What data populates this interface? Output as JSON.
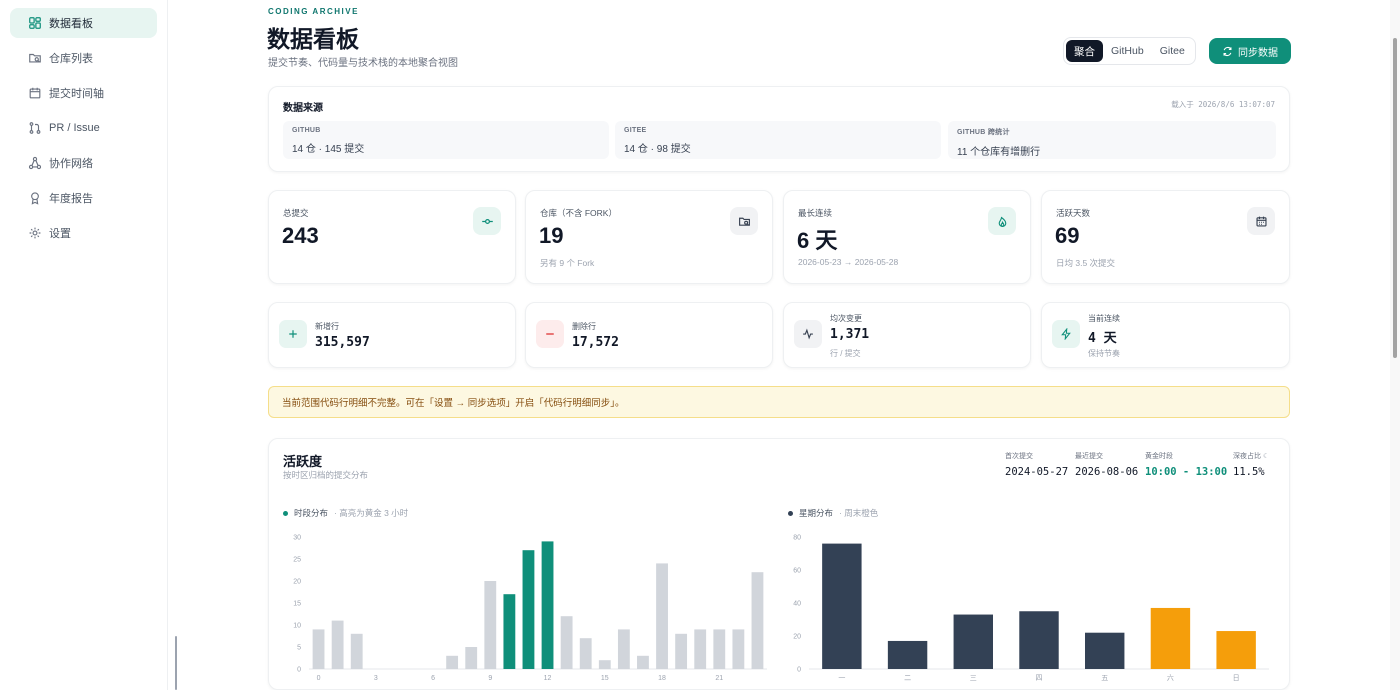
{
  "sidebar": {
    "items": [
      {
        "label": "数据看板",
        "icon": "dashboard-icon",
        "active": true
      },
      {
        "label": "仓库列表",
        "icon": "folder-search-icon"
      },
      {
        "label": "提交时间轴",
        "icon": "calendar-icon"
      },
      {
        "label": "PR / Issue",
        "icon": "git-pull-request-icon"
      },
      {
        "label": "协作网络",
        "icon": "network-icon"
      },
      {
        "label": "年度报告",
        "icon": "award-icon"
      },
      {
        "label": "设置",
        "icon": "gear-icon"
      }
    ]
  },
  "header": {
    "eyebrow": "CODING ARCHIVE",
    "title": "数据看板",
    "subtitle": "提交节奏、代码量与技术栈的本地聚合视图",
    "sources": [
      "聚合",
      "GitHub",
      "Gitee"
    ],
    "active_source": "聚合",
    "sync_label": "同步数据",
    "sync_icon": "refresh-icon"
  },
  "data_source": {
    "title": "数据来源",
    "loaded_at": "载入于 2026/8/6 13:07:07",
    "cells": [
      {
        "label": "GITHUB",
        "value": "14 仓 · 145 提交"
      },
      {
        "label": "GITEE",
        "value": "14 仓 · 98 提交"
      },
      {
        "label": "GITHUB 跨统计",
        "value": "11 个仓库有增删行"
      }
    ]
  },
  "stats": [
    {
      "label": "总提交",
      "value": "243",
      "sub": "",
      "icon": "commit-icon"
    },
    {
      "label": "仓库（不含 FORK）",
      "value": "19",
      "sub": "另有 9 个 Fork",
      "icon": "folder-search-icon"
    },
    {
      "label": "最长连续",
      "value": "6 天",
      "sub": "2026-05-23 → 2026-05-28",
      "icon": "flame-icon"
    },
    {
      "label": "活跃天数",
      "value": "69",
      "sub": "日均 3.5 次提交",
      "icon": "calendar-icon"
    }
  ],
  "metrics": [
    {
      "label": "新增行",
      "value": "315,597",
      "sub": "",
      "icon": "plus-icon"
    },
    {
      "label": "删除行",
      "value": "17,572",
      "sub": "",
      "icon": "minus-icon"
    },
    {
      "label": "均次变更",
      "value": "1,371",
      "sub": "行 / 提交",
      "icon": "activity-icon"
    },
    {
      "label": "当前连续",
      "value": "4 天",
      "sub": "保持节奏",
      "icon": "zap-icon"
    }
  ],
  "warning": "当前范围代码行明细不完整。可在「设置 → 同步选项」开启「代码行明细同步」。",
  "activity": {
    "title": "活跃度",
    "subtitle": "按时区归档的提交分布",
    "kpis": [
      {
        "label": "首次提交",
        "value": "2024-05-27"
      },
      {
        "label": "最近提交",
        "value": "2026-08-06"
      },
      {
        "label": "黄金时段",
        "value": "10:00 - 13:00"
      },
      {
        "label": "深夜占比",
        "value": "11.5%"
      }
    ],
    "hour_chart_title": "时段分布",
    "hour_chart_note": "· 高亮为黄金 3 小时",
    "week_chart_title": "星期分布",
    "week_chart_note": "· 周末橙色"
  },
  "colors": {
    "accent": "#0f8f7a",
    "bar_gray": "#d1d5db",
    "bar_dark": "#334155",
    "weekend": "#f59e0b"
  },
  "chart_data": [
    {
      "type": "bar",
      "title": "时段分布",
      "x": [
        0,
        1,
        2,
        3,
        4,
        5,
        6,
        7,
        8,
        9,
        10,
        11,
        12,
        13,
        14,
        15,
        16,
        17,
        18,
        19,
        20,
        21,
        22,
        23
      ],
      "values": [
        9,
        11,
        8,
        0,
        0,
        0,
        0,
        3,
        5,
        20,
        17,
        27,
        29,
        12,
        7,
        2,
        9,
        3,
        24,
        8,
        9,
        9,
        9,
        22
      ],
      "highlight": [
        10,
        11,
        12
      ],
      "x_ticks": [
        "0",
        "3",
        "6",
        "9",
        "12",
        "15",
        "18",
        "21"
      ],
      "ylim": [
        0,
        30
      ],
      "y_ticks": [
        0,
        5,
        10,
        15,
        20,
        25,
        30
      ]
    },
    {
      "type": "bar",
      "title": "星期分布",
      "categories": [
        "一",
        "二",
        "三",
        "四",
        "五",
        "六",
        "日"
      ],
      "values": [
        76,
        17,
        33,
        35,
        22,
        37,
        23
      ],
      "weekend": [
        "六",
        "日"
      ],
      "ylim": [
        0,
        80
      ],
      "y_ticks": [
        0,
        20,
        40,
        60,
        80
      ]
    }
  ]
}
